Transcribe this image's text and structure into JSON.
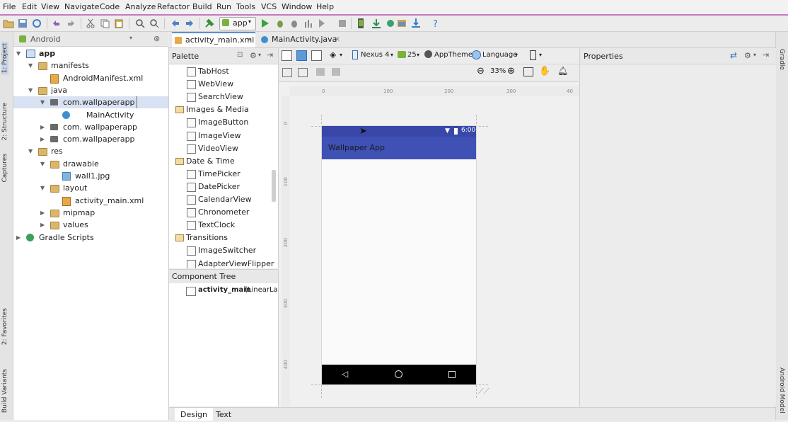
{
  "menu": [
    "File",
    "Edit",
    "View",
    "Navigate",
    "Code",
    "Analyze",
    "Refactor",
    "Build",
    "Run",
    "Tools",
    "VCS",
    "Window",
    "Help"
  ],
  "toolbar": {
    "run_config": "app"
  },
  "left_strip": {
    "project": "1: Project",
    "structure": "2: Structure",
    "captures": "Captures",
    "favorites": "2: Favorites",
    "build_variants": "Build Variants"
  },
  "right_strip": {
    "gradle": "Gradle",
    "android_model": "Android Model"
  },
  "project_panel": {
    "view_mode": "Android",
    "tree": [
      {
        "label": "app",
        "depth": 0,
        "arrow": "open",
        "icon": "module",
        "bold": true
      },
      {
        "label": "manifests",
        "depth": 1,
        "arrow": "open",
        "icon": "folder"
      },
      {
        "label": "AndroidManifest.xml",
        "depth": 2,
        "arrow": "",
        "icon": "xml"
      },
      {
        "label": "java",
        "depth": 1,
        "arrow": "open",
        "icon": "folder"
      },
      {
        "label": "com.wallpaperapp",
        "depth": 2,
        "arrow": "open",
        "icon": "package",
        "selected": true
      },
      {
        "label": "MainActivity",
        "depth": 3,
        "arrow": "",
        "icon": "class"
      },
      {
        "label": "com. wallpaperapp",
        "depth": 2,
        "arrow": "closed",
        "icon": "package"
      },
      {
        "label": "com.wallpaperapp",
        "depth": 2,
        "arrow": "closed",
        "icon": "package"
      },
      {
        "label": "res",
        "depth": 1,
        "arrow": "open",
        "icon": "folder"
      },
      {
        "label": "drawable",
        "depth": 2,
        "arrow": "open",
        "icon": "folder"
      },
      {
        "label": "wall1.jpg",
        "depth": 3,
        "arrow": "",
        "icon": "image"
      },
      {
        "label": "layout",
        "depth": 2,
        "arrow": "open",
        "icon": "folder"
      },
      {
        "label": "activity_main.xml",
        "depth": 3,
        "arrow": "",
        "icon": "xml"
      },
      {
        "label": "mipmap",
        "depth": 2,
        "arrow": "closed",
        "icon": "folder"
      },
      {
        "label": "values",
        "depth": 2,
        "arrow": "closed",
        "icon": "folder"
      },
      {
        "label": "Gradle Scripts",
        "depth": 0,
        "arrow": "closed",
        "icon": "gradle"
      }
    ]
  },
  "editor_tabs": [
    {
      "label": "activity_main.xml",
      "active": true
    },
    {
      "label": "MainActivity.java",
      "active": false
    }
  ],
  "palette": {
    "title": "Palette",
    "items": [
      {
        "label": "TabHost",
        "group": false
      },
      {
        "label": "WebView",
        "group": false
      },
      {
        "label": "SearchView",
        "group": false
      },
      {
        "label": "Images & Media",
        "group": true
      },
      {
        "label": "ImageButton",
        "group": false
      },
      {
        "label": "ImageView",
        "group": false
      },
      {
        "label": "VideoView",
        "group": false
      },
      {
        "label": "Date & Time",
        "group": true
      },
      {
        "label": "TimePicker",
        "group": false
      },
      {
        "label": "DatePicker",
        "group": false
      },
      {
        "label": "CalendarView",
        "group": false
      },
      {
        "label": "Chronometer",
        "group": false
      },
      {
        "label": "TextClock",
        "group": false
      },
      {
        "label": "Transitions",
        "group": true
      },
      {
        "label": "ImageSwitcher",
        "group": false
      },
      {
        "label": "AdapterViewFlipper",
        "group": false
      }
    ]
  },
  "component_tree": {
    "title": "Component Tree",
    "root_name": "activity_main",
    "root_type": " (LinearLayout)"
  },
  "design_toolbar": {
    "device": "Nexus 4",
    "api": "25",
    "theme": "AppTheme",
    "language": "Language",
    "zoom": "33%"
  },
  "rulers": {
    "top": [
      "0",
      "100",
      "200",
      "300",
      "40"
    ],
    "left": [
      "0",
      "100",
      "200",
      "300",
      "400"
    ]
  },
  "device_preview": {
    "time": "6:00",
    "app_title": "Wallpaper App"
  },
  "properties": {
    "title": "Properties"
  },
  "bottom_tabs": [
    {
      "label": "Design",
      "active": true
    },
    {
      "label": "Text",
      "active": false
    }
  ],
  "colors": {
    "accent_bar": "#c778c7",
    "status_bar": "#3948a8",
    "action_bar": "#3f51b5",
    "selected_row": "#d9e2f2"
  }
}
